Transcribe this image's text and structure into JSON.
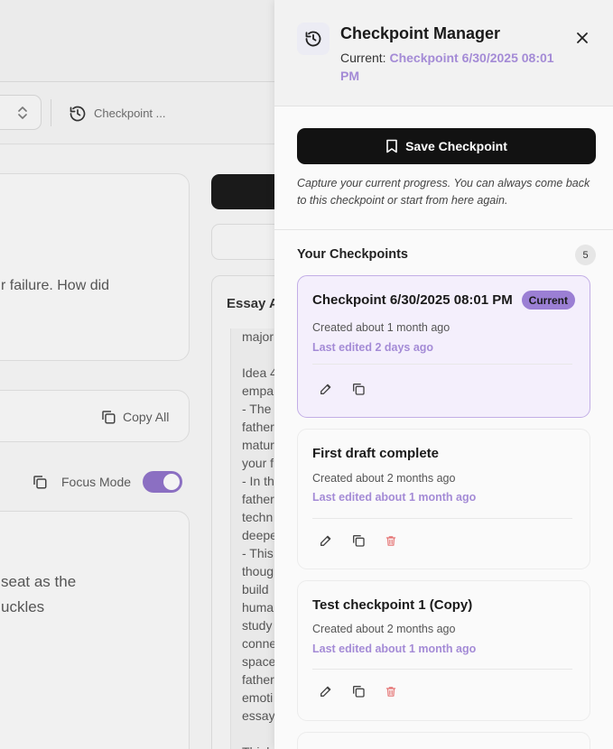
{
  "background": {
    "toolbar_checkpoint_label": "Checkpoint ...",
    "prompt_text": "r failure. How did",
    "copy_all_label": "Copy All",
    "focus_mode_label": "Focus Mode",
    "editor_lines": [
      "seat as the",
      "uckles"
    ],
    "essay_title": "Essay A",
    "essay_lines": [
      "major",
      "",
      "Idea 4",
      "empa",
      "- The",
      "father",
      "matur",
      "your f",
      "- In th",
      "father",
      "techn",
      "deepe",
      "- This",
      "thoug",
      "build",
      "huma",
      "study",
      "conne",
      "space",
      "father",
      "emoti",
      "essay",
      "",
      "Thinl"
    ]
  },
  "panel": {
    "title": "Checkpoint Manager",
    "current_label": "Current:",
    "current_value": "Checkpoint 6/30/2025 08:01 PM",
    "save_button_label": "Save Checkpoint",
    "save_hint": "Capture your current progress. You can always come back to this checkpoint or start from here again.",
    "list_title": "Your Checkpoints",
    "count": "5",
    "checkpoints": [
      {
        "name": "Checkpoint 6/30/2025 08:01 PM",
        "badge": "Current",
        "created": "Created about 1 month ago",
        "edited": "Last edited 2 days ago"
      },
      {
        "name": "First draft complete",
        "created": "Created about 2 months ago",
        "edited": "Last edited about 1 month ago"
      },
      {
        "name": "Test checkpoint 1 (Copy)",
        "created": "Created about 2 months ago",
        "edited": "Last edited about 1 month ago"
      }
    ]
  },
  "colors": {
    "accent": "#a48bd6",
    "badge": "#9b7fd4",
    "primary_button": "#121212",
    "delete": "#e57373"
  },
  "icons": [
    "history-icon",
    "close-icon",
    "bookmark-icon",
    "pencil-icon",
    "copy-icon",
    "trash-icon",
    "updown-icon"
  ]
}
